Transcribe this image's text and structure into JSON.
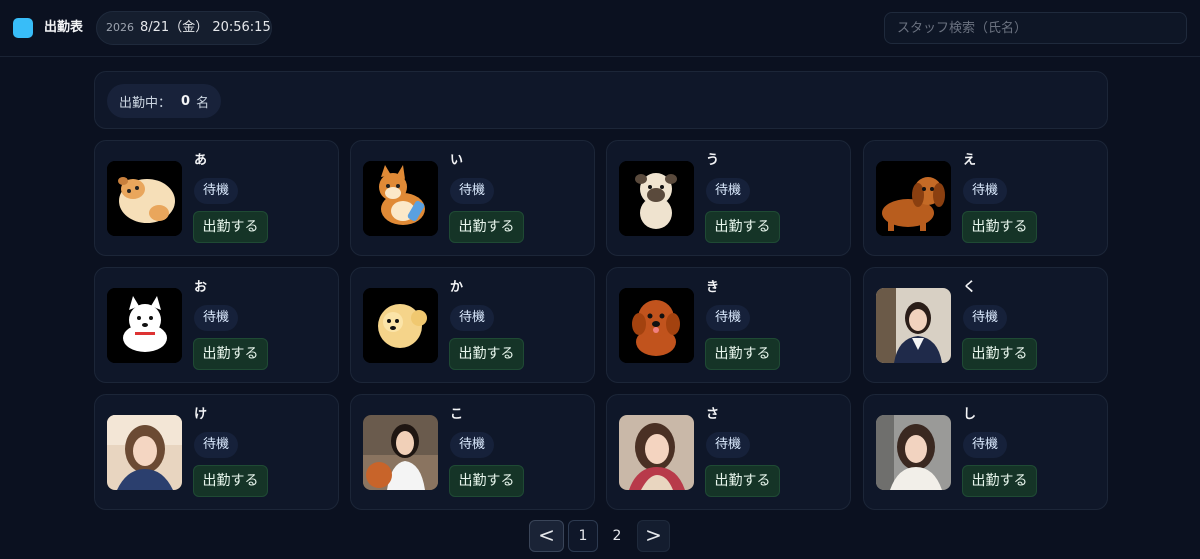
{
  "header": {
    "app_title": "出勤表",
    "year": "2026",
    "datetime": "8/21（金） 20:56:15",
    "search_placeholder": "スタッフ検索（氏名）",
    "logo_color": "#38bdf8"
  },
  "summary": {
    "label": "出勤中：",
    "count": "0",
    "unit": "名"
  },
  "staff": [
    {
      "name": "あ",
      "status": "待機",
      "action": "出勤する",
      "avatar": "dog-curled-icon"
    },
    {
      "name": "い",
      "status": "待機",
      "action": "出勤する",
      "avatar": "shiba-dog-icon"
    },
    {
      "name": "う",
      "status": "待機",
      "action": "出勤する",
      "avatar": "pug-dog-icon"
    },
    {
      "name": "え",
      "status": "待機",
      "action": "出勤する",
      "avatar": "dachshund-dog-icon"
    },
    {
      "name": "お",
      "status": "待機",
      "action": "出勤する",
      "avatar": "white-dog-icon"
    },
    {
      "name": "か",
      "status": "待機",
      "action": "出勤する",
      "avatar": "pomeranian-dog-icon"
    },
    {
      "name": "き",
      "status": "待機",
      "action": "出勤する",
      "avatar": "poodle-dog-icon"
    },
    {
      "name": "く",
      "status": "待機",
      "action": "出勤する",
      "avatar": "woman-photo"
    },
    {
      "name": "け",
      "status": "待機",
      "action": "出勤する",
      "avatar": "woman-photo"
    },
    {
      "name": "こ",
      "status": "待機",
      "action": "出勤する",
      "avatar": "woman-photo"
    },
    {
      "name": "さ",
      "status": "待機",
      "action": "出勤する",
      "avatar": "woman-photo"
    },
    {
      "name": "し",
      "status": "待機",
      "action": "出勤する",
      "avatar": "woman-photo"
    }
  ],
  "pagination": {
    "prev": "<",
    "pages": [
      "1",
      "2"
    ],
    "current": "1",
    "next": ">"
  },
  "colors": {
    "background": "#0b1120",
    "card": "#0f1729",
    "action_button": "#153427"
  }
}
